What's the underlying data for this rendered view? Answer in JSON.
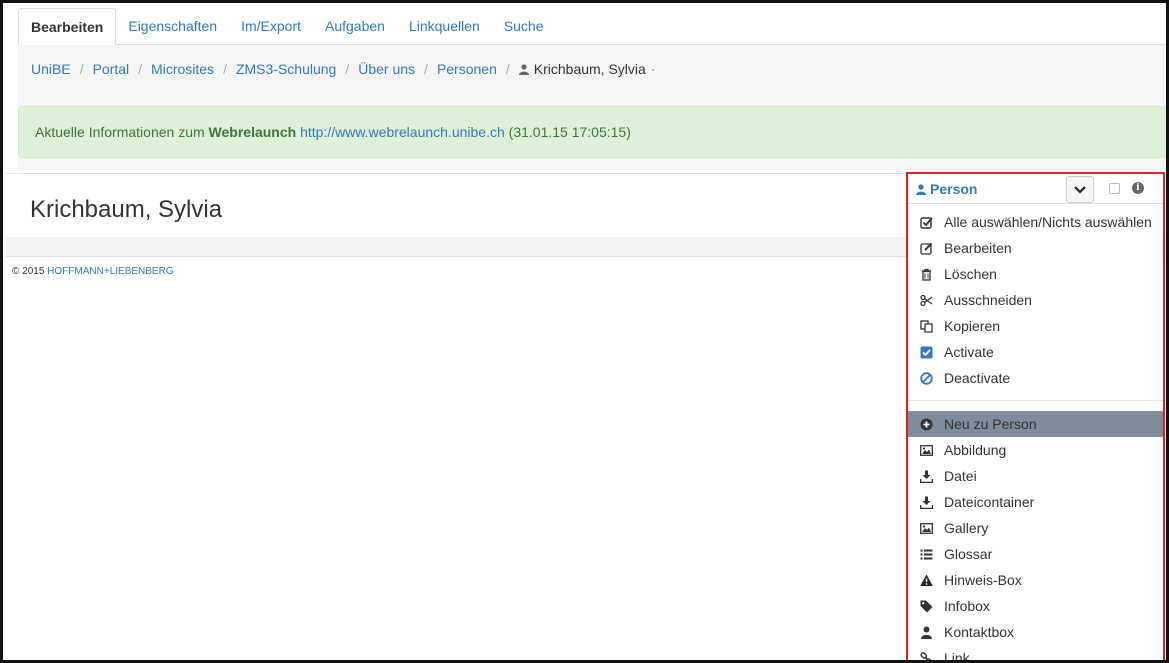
{
  "tabs": [
    {
      "label": "Bearbeiten",
      "active": true
    },
    {
      "label": "Eigenschaften"
    },
    {
      "label": "Im/Export"
    },
    {
      "label": "Aufgaben"
    },
    {
      "label": "Linkquellen"
    },
    {
      "label": "Suche"
    }
  ],
  "breadcrumb": {
    "links": [
      "UniBE",
      "Portal",
      "Microsites",
      "ZMS3-Schulung",
      "Über uns",
      "Personen"
    ],
    "separator": "/",
    "current": "Krichbaum, Sylvia",
    "current_suffix": "·"
  },
  "alert": {
    "prefix": "Aktuelle Informationen zum ",
    "bold": "Webrelaunch",
    "link": "http://www.webrelaunch.unibe.ch",
    "suffix": "(31.01.15 17:05:15)"
  },
  "page": {
    "title": "Krichbaum, Sylvia"
  },
  "footer": {
    "copyright": "© 2015",
    "company": "HOFFMANN+LIEBENBERG"
  },
  "panel": {
    "title": "Person",
    "actions": [
      {
        "label": "Alle auswählen/Nichts auswählen",
        "icon": "check-square-icon"
      },
      {
        "label": "Bearbeiten",
        "icon": "edit-icon"
      },
      {
        "label": "Löschen",
        "icon": "trash-icon"
      },
      {
        "label": "Ausschneiden",
        "icon": "scissors-icon"
      },
      {
        "label": "Kopieren",
        "icon": "copy-icon"
      },
      {
        "label": "Activate",
        "icon": "checkbox-checked-icon"
      },
      {
        "label": "Deactivate",
        "icon": "ban-icon"
      }
    ],
    "new_header": "Neu zu Person",
    "new_items": [
      {
        "label": "Abbildung",
        "icon": "picture-icon"
      },
      {
        "label": "Datei",
        "icon": "download-icon"
      },
      {
        "label": "Dateicontainer",
        "icon": "download-icon"
      },
      {
        "label": "Gallery",
        "icon": "picture-icon"
      },
      {
        "label": "Glossar",
        "icon": "list-icon"
      },
      {
        "label": "Hinweis-Box",
        "icon": "warning-icon"
      },
      {
        "label": "Infobox",
        "icon": "tag-icon"
      },
      {
        "label": "Kontaktbox",
        "icon": "user-icon"
      },
      {
        "label": "Link",
        "icon": "link-icon"
      }
    ],
    "highlight_color": "#7f8c9a",
    "border_color": "#d9222a"
  }
}
